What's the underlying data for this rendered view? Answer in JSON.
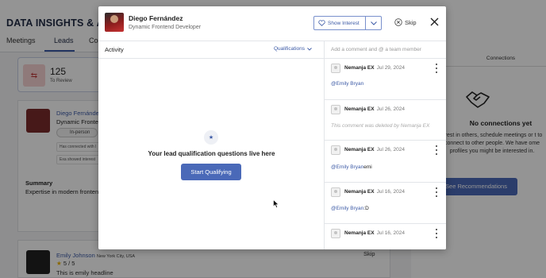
{
  "background": {
    "page_title": "DATA INSIGHTS & ANAL",
    "tabs": [
      "Meetings",
      "Leads",
      "Co"
    ],
    "stat": {
      "value": "125",
      "label": "To Review"
    },
    "lead_card": {
      "name": "Diego Fernández",
      "role": "Dynamic Fronten",
      "chip": "In-person",
      "lines": [
        "Has connected with l",
        "Exa showed interest"
      ],
      "summary_label": "Summary",
      "summary_text": "Expertise in modern frontend"
    },
    "second_card": {
      "name": "Emily Johnson",
      "location": "New York City, USA",
      "rating": "5 / 5",
      "headline": "This is emily headline",
      "skip_label": "Skip"
    },
    "connections": {
      "tab": "Connections",
      "title": "No connections yet",
      "text": "erest in others, schedule meetings or t to connect to other people. We have ome profiles you might be interested in.",
      "button": "See Recommendations"
    }
  },
  "modal": {
    "header": {
      "name": "Diego Fernández",
      "role": "Dynamic Frontend Developer",
      "interest_label": "Show Interest",
      "skip_label": "Skip"
    },
    "activity": {
      "title": "Activity",
      "filter_label": "Qualifications",
      "empty_text": "Your lead qualification questions live here",
      "start_button": "Start Qualifying"
    },
    "comments": {
      "placeholder": "Add a comment and @ a team member",
      "items": [
        {
          "author": "Nemanja EX",
          "date": "Jul 29, 2024",
          "mention": "@Emily Bryan",
          "text": ""
        },
        {
          "author": "Nemanja EX",
          "date": "Jul 26, 2024",
          "deleted": "This comment was deleted by Nemanja EX"
        },
        {
          "author": "Nemanja EX",
          "date": "Jul 26, 2024",
          "mention": "@Emily Bryan",
          "text": "emi"
        },
        {
          "author": "Nemanja EX",
          "date": "Jul 16, 2024",
          "mention": "@Emily Bryan",
          "text": ":D"
        },
        {
          "author": "Nemanja EX",
          "date": "Jul 16, 2024",
          "mention": "",
          "text": ""
        }
      ]
    }
  },
  "colors": {
    "accent": "#4a69b8",
    "link": "#3c5aa6"
  }
}
